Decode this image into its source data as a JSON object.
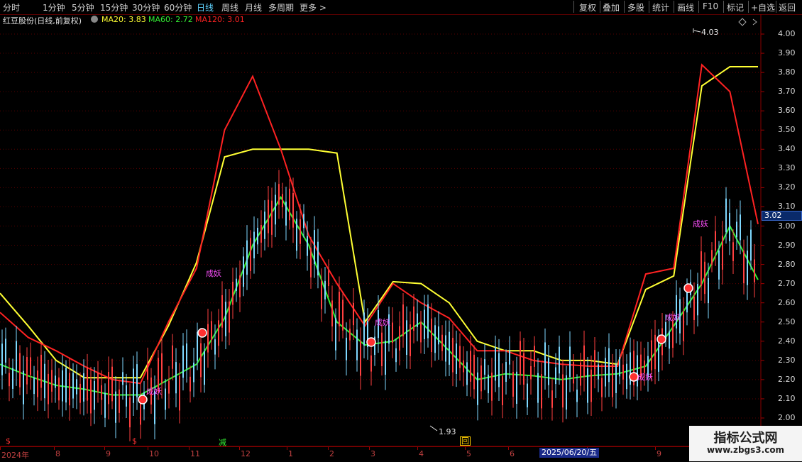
{
  "toolbar": {
    "periods": [
      "分时",
      "1分钟",
      "5分钟",
      "15分钟",
      "30分钟",
      "60分钟",
      "日线",
      "周线",
      "月线",
      "多周期",
      "更多 >"
    ],
    "active_period": "日线",
    "actions": [
      "复权",
      "叠加",
      "多股",
      "统计",
      "画线",
      "F10",
      "标记",
      "+自选",
      "返回"
    ]
  },
  "info": {
    "stock": "红豆股份(日线,前复权)",
    "ma20": "MA20: 3.83",
    "ma60": "MA60: 2.72",
    "ma120": "MA120: 3.01",
    "colors": {
      "ma20": "#ffff33",
      "ma60": "#33ee33",
      "ma120": "#ff2222"
    }
  },
  "price_axis": {
    "ticks": [
      "4.00",
      "3.90",
      "3.80",
      "3.70",
      "3.60",
      "3.50",
      "3.40",
      "3.30",
      "3.20",
      "3.10",
      "3.00",
      "2.90",
      "2.80",
      "2.70",
      "2.60",
      "2.50",
      "2.40",
      "2.30",
      "2.20",
      "2.10",
      "2.00"
    ],
    "last_price": "3.02"
  },
  "date_axis": {
    "labels": [
      "2024年",
      "8",
      "9",
      "10",
      "11",
      "12",
      "1",
      "2",
      "3",
      "4",
      "5",
      "6",
      "8",
      "9"
    ],
    "cursor_date": "2025/06/20/五"
  },
  "chart_annotations": {
    "high_label": "4.03",
    "low_label": "1.93",
    "signals": [
      "成妖",
      "成妖",
      "成妖",
      "成妖",
      "成妖",
      "成妖"
    ],
    "bottom_markers": [
      "$",
      "$",
      "减",
      "回"
    ]
  },
  "chart_data": {
    "type": "line",
    "title": "红豆股份(日线,前复权)",
    "ylim": [
      1.93,
      4.05
    ],
    "categories": [
      "2024-07",
      "2024-08",
      "2024-09",
      "2024-10",
      "2024-11",
      "2024-12",
      "2025-01",
      "2025-02",
      "2025-03",
      "2025-04",
      "2025-05",
      "2025-06",
      "2025-08",
      "2025-09"
    ],
    "series": [
      {
        "name": "MA20",
        "color": "#ffff33",
        "values": [
          2.65,
          2.48,
          2.3,
          2.21,
          2.21,
          2.21,
          2.48,
          2.81,
          3.36,
          3.4,
          3.4,
          3.4,
          3.38,
          2.5,
          2.71,
          2.7,
          2.6,
          2.4,
          2.35,
          2.35,
          2.3,
          2.3,
          2.28,
          2.67,
          2.74,
          3.73,
          3.83,
          3.83
        ]
      },
      {
        "name": "MA60",
        "color": "#33ee33",
        "values": [
          2.28,
          2.22,
          2.17,
          2.15,
          2.12,
          2.12,
          2.2,
          2.28,
          2.52,
          2.9,
          3.15,
          2.9,
          2.5,
          2.38,
          2.4,
          2.5,
          2.35,
          2.2,
          2.23,
          2.22,
          2.2,
          2.22,
          2.23,
          2.27,
          2.48,
          2.7,
          3.0,
          2.72
        ]
      },
      {
        "name": "MA120",
        "color": "#ff2222",
        "values": [
          2.55,
          2.42,
          2.35,
          2.27,
          2.2,
          2.18,
          2.5,
          2.78,
          3.5,
          3.78,
          3.4,
          2.95,
          2.7,
          2.48,
          2.7,
          2.6,
          2.52,
          2.35,
          2.35,
          2.3,
          2.28,
          2.27,
          2.27,
          2.75,
          2.78,
          3.84,
          3.7,
          3.01
        ]
      }
    ]
  }
}
